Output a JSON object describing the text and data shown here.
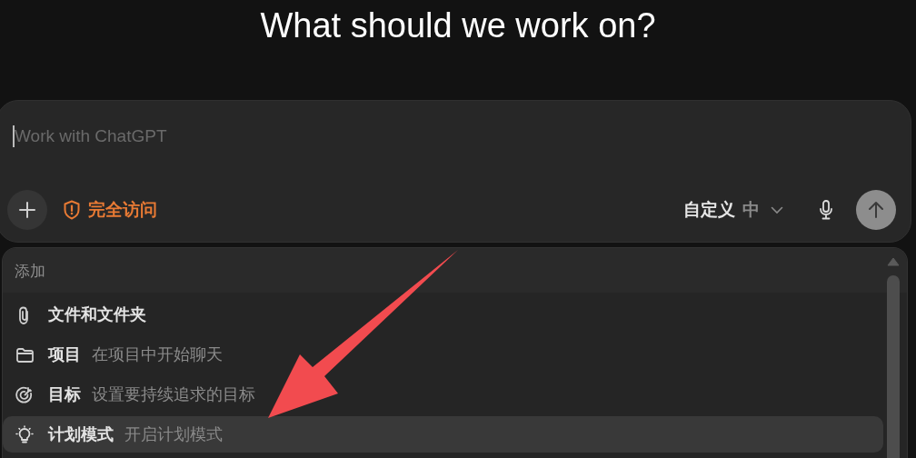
{
  "heading": "What should we work on?",
  "composer": {
    "placeholder": "Work with ChatGPT",
    "access_label": "完全访问",
    "model_label": "自定义",
    "effort_label": "中"
  },
  "menu": {
    "header": "添加",
    "items": [
      {
        "title": "文件和文件夹",
        "selected": false
      },
      {
        "title": "项目",
        "description": "在项目中开始聊天",
        "selected": false
      },
      {
        "title": "目标",
        "description": "设置要持续追求的目标",
        "selected": false
      },
      {
        "title": "计划模式",
        "description": "开启计划模式",
        "selected": true
      }
    ]
  }
}
